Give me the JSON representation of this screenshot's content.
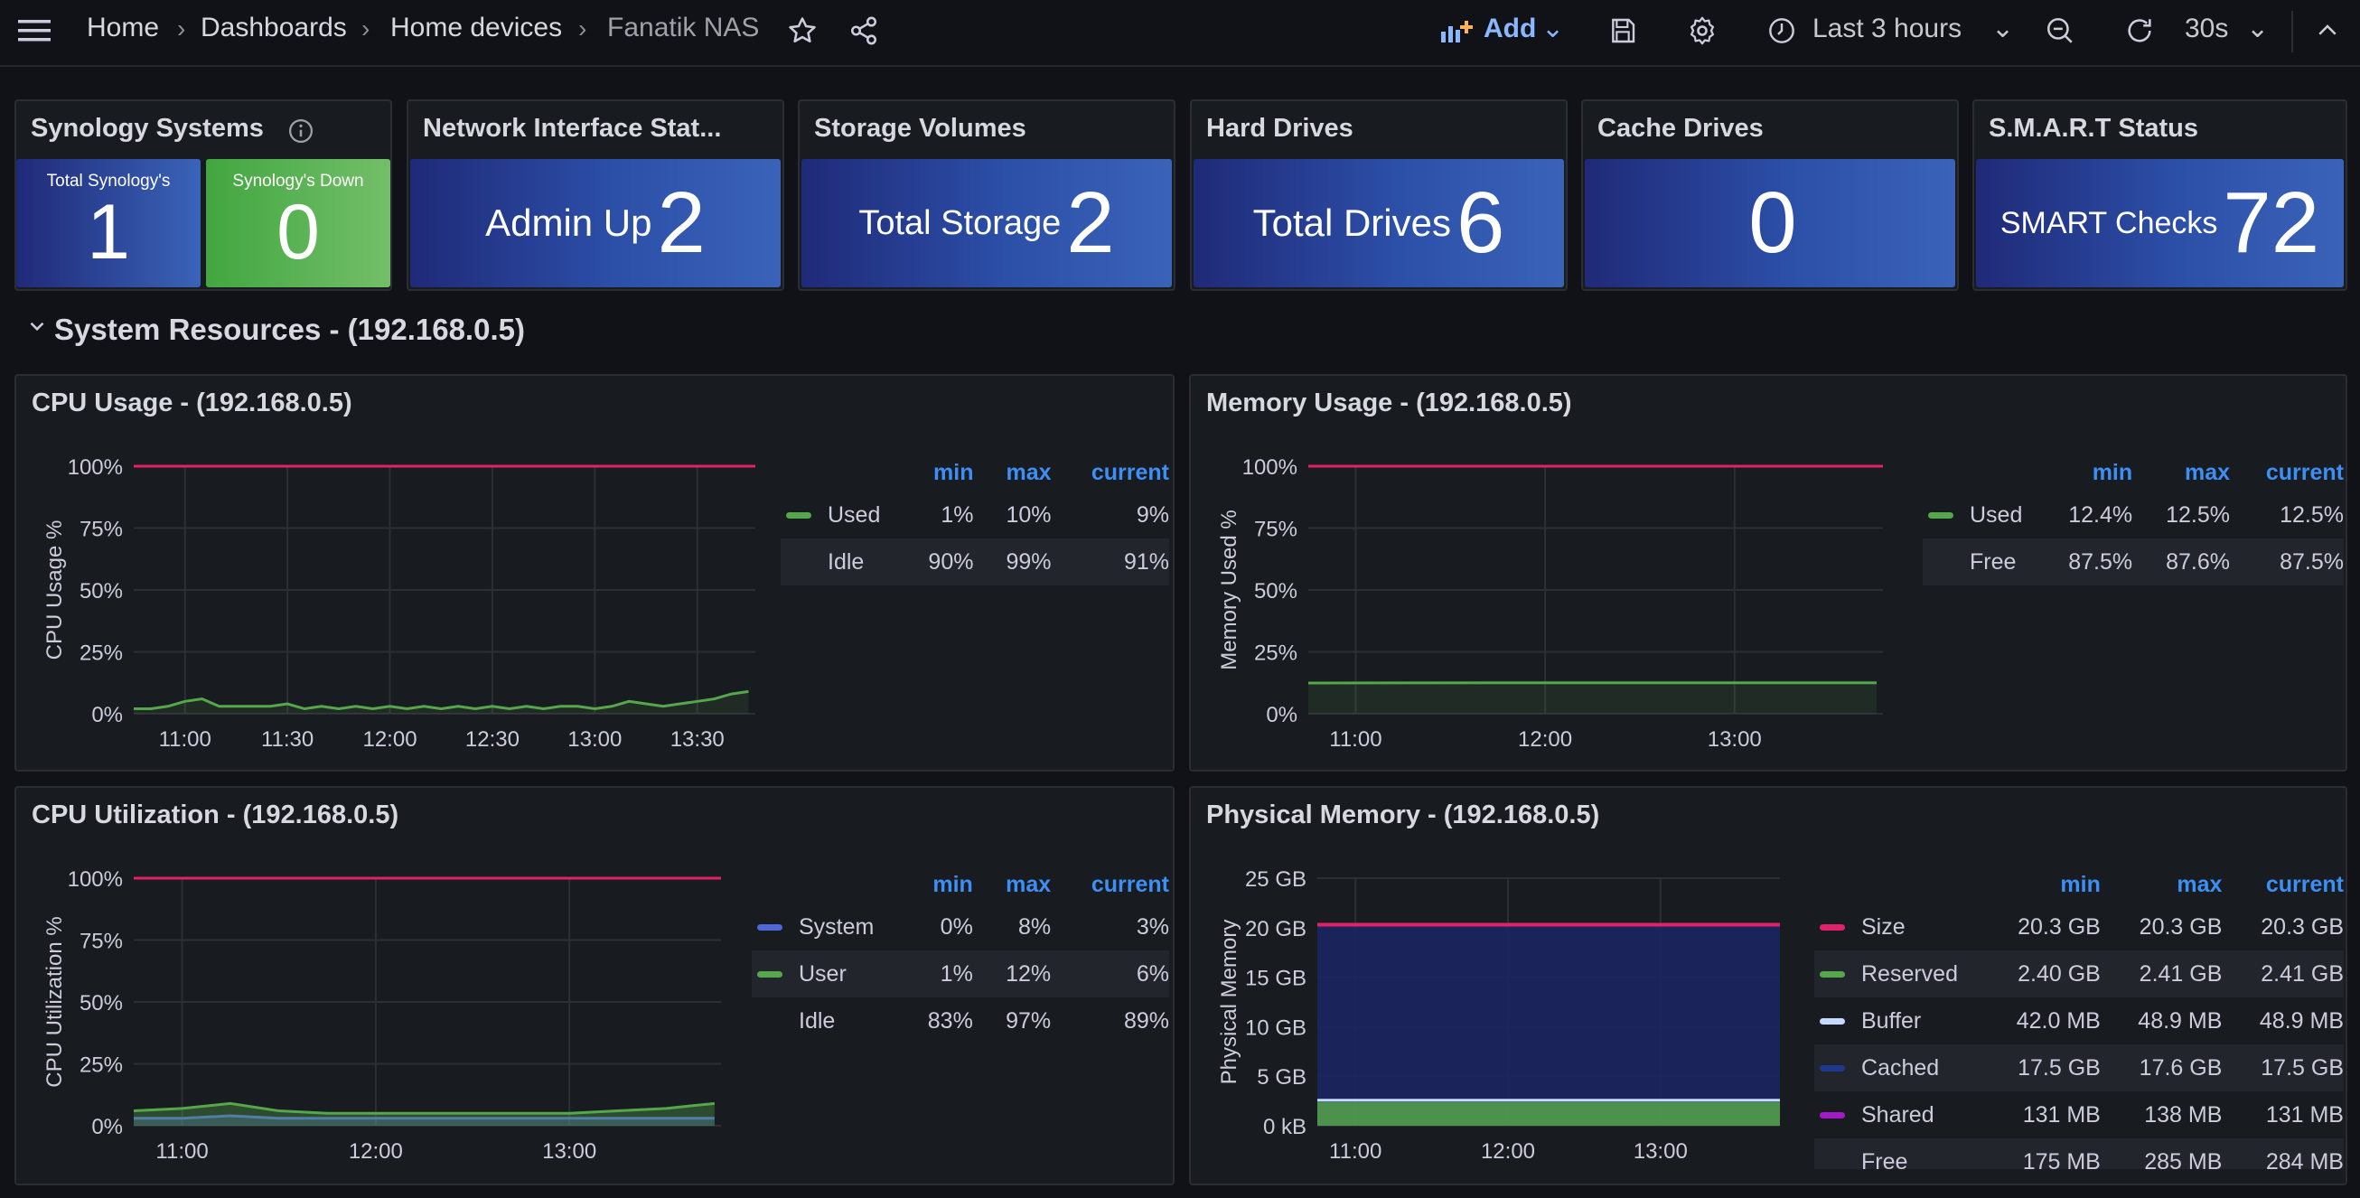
{
  "nav": {
    "breadcrumb": [
      "Home",
      "Dashboards",
      "Home devices",
      "Fanatik NAS"
    ],
    "add_label": "Add",
    "time_range": "Last 3 hours",
    "refresh_interval": "30s"
  },
  "stats": {
    "synology": {
      "title": "Synology Systems",
      "total_label": "Total Synology's",
      "total_value": "1",
      "down_label": "Synology's Down",
      "down_value": "0"
    },
    "network": {
      "title": "Network Interface Stat...",
      "label": "Admin Up",
      "value": "2"
    },
    "storage": {
      "title": "Storage Volumes",
      "label": "Total Storage",
      "value": "2"
    },
    "drives": {
      "title": "Hard Drives",
      "label": "Total Drives",
      "value": "6"
    },
    "cache": {
      "title": "Cache Drives",
      "label": "",
      "value": "0"
    },
    "smart": {
      "title": "S.M.A.R.T Status",
      "label": "SMART Checks",
      "value": "72"
    }
  },
  "row": {
    "title": "System Resources - (192.168.0.5)"
  },
  "colors": {
    "green": "#56a64b",
    "red": "#e0226e",
    "blue": "#5067d8",
    "white": "#c8d9ff",
    "darkblue": "#1f3a8c",
    "purple": "#a31ac7"
  },
  "legend_headers": {
    "min": "min",
    "max": "max",
    "current": "current"
  },
  "cpu_usage": {
    "title": "CPU Usage - (192.168.0.5)",
    "legend": [
      {
        "name": "Used",
        "min": "1%",
        "max": "10%",
        "current": "9%",
        "color": "#56a64b"
      },
      {
        "name": "Idle",
        "min": "90%",
        "max": "99%",
        "current": "91%",
        "color": ""
      }
    ]
  },
  "memory_usage": {
    "title": "Memory Usage - (192.168.0.5)",
    "legend": [
      {
        "name": "Used",
        "min": "12.4%",
        "max": "12.5%",
        "current": "12.5%",
        "color": "#56a64b"
      },
      {
        "name": "Free",
        "min": "87.5%",
        "max": "87.6%",
        "current": "87.5%",
        "color": ""
      }
    ]
  },
  "cpu_util": {
    "title": "CPU Utilization - (192.168.0.5)",
    "legend": [
      {
        "name": "System",
        "min": "0%",
        "max": "8%",
        "current": "3%",
        "color": "#5067d8"
      },
      {
        "name": "User",
        "min": "1%",
        "max": "12%",
        "current": "6%",
        "color": "#56a64b"
      },
      {
        "name": "Idle",
        "min": "83%",
        "max": "97%",
        "current": "89%",
        "color": ""
      }
    ]
  },
  "phys_mem": {
    "title": "Physical Memory - (192.168.0.5)",
    "legend": [
      {
        "name": "Size",
        "min": "20.3 GB",
        "max": "20.3 GB",
        "current": "20.3 GB",
        "color": "#e0226e"
      },
      {
        "name": "Reserved",
        "min": "2.40 GB",
        "max": "2.41 GB",
        "current": "2.41 GB",
        "color": "#56a64b"
      },
      {
        "name": "Buffer",
        "min": "42.0 MB",
        "max": "48.9 MB",
        "current": "48.9 MB",
        "color": "#c8d9ff"
      },
      {
        "name": "Cached",
        "min": "17.5 GB",
        "max": "17.6 GB",
        "current": "17.5 GB",
        "color": "#1f3a8c"
      },
      {
        "name": "Shared",
        "min": "131 MB",
        "max": "138 MB",
        "current": "131 MB",
        "color": "#a31ac7"
      },
      {
        "name": "Free",
        "min": "175 MB",
        "max": "285 MB",
        "current": "284 MB",
        "color": ""
      }
    ]
  },
  "chart_data": [
    {
      "type": "line",
      "title": "CPU Usage - (192.168.0.5)",
      "ylabel": "CPU Usage %",
      "ylim": [
        0,
        100
      ],
      "yticks": [
        "0%",
        "25%",
        "50%",
        "75%",
        "100%"
      ],
      "xticks": [
        "11:00",
        "11:30",
        "12:00",
        "12:30",
        "13:00",
        "13:30"
      ],
      "x": [
        "10:45",
        "10:50",
        "10:55",
        "11:00",
        "11:05",
        "11:10",
        "11:15",
        "11:20",
        "11:25",
        "11:30",
        "11:35",
        "11:40",
        "11:45",
        "11:50",
        "11:55",
        "12:00",
        "12:05",
        "12:10",
        "12:15",
        "12:20",
        "12:25",
        "12:30",
        "12:35",
        "12:40",
        "12:45",
        "12:50",
        "12:55",
        "13:00",
        "13:05",
        "13:10",
        "13:15",
        "13:20",
        "13:25",
        "13:30",
        "13:35",
        "13:40",
        "13:45"
      ],
      "series": [
        {
          "name": "Used",
          "values": [
            2,
            2,
            3,
            5,
            6,
            3,
            3,
            3,
            3,
            4,
            2,
            3,
            2,
            3,
            2,
            3,
            2,
            3,
            2,
            3,
            2,
            3,
            2,
            3,
            2,
            3,
            3,
            2,
            3,
            5,
            4,
            3,
            4,
            5,
            6,
            8,
            9
          ]
        }
      ],
      "threshold": 100
    },
    {
      "type": "line",
      "title": "Memory Usage - (192.168.0.5)",
      "ylabel": "Memory Used %",
      "ylim": [
        0,
        100
      ],
      "yticks": [
        "0%",
        "25%",
        "50%",
        "75%",
        "100%"
      ],
      "xticks": [
        "11:00",
        "12:00",
        "13:00"
      ],
      "x": [
        "10:45",
        "11:45",
        "12:45",
        "13:45"
      ],
      "series": [
        {
          "name": "Used",
          "values": [
            12.4,
            12.5,
            12.5,
            12.5
          ]
        }
      ],
      "threshold": 100
    },
    {
      "type": "area",
      "title": "CPU Utilization - (192.168.0.5)",
      "ylabel": "CPU Utilization %",
      "ylim": [
        0,
        100
      ],
      "yticks": [
        "0%",
        "25%",
        "50%",
        "75%",
        "100%"
      ],
      "xticks": [
        "11:00",
        "12:00",
        "13:00"
      ],
      "x": [
        "10:45",
        "11:00",
        "11:15",
        "11:30",
        "11:45",
        "12:00",
        "12:15",
        "12:30",
        "12:45",
        "13:00",
        "13:15",
        "13:30",
        "13:45"
      ],
      "series": [
        {
          "name": "System",
          "values": [
            3,
            3,
            4,
            3,
            3,
            3,
            3,
            3,
            3,
            3,
            3,
            3,
            3
          ]
        },
        {
          "name": "User",
          "values": [
            6,
            7,
            9,
            6,
            5,
            5,
            5,
            5,
            5,
            5,
            6,
            7,
            9
          ]
        }
      ],
      "threshold": 100
    },
    {
      "type": "area",
      "title": "Physical Memory - (192.168.0.5)",
      "ylabel": "Physical Memory",
      "ylim": [
        0,
        25
      ],
      "yticks": [
        "0 kB",
        "5 GB",
        "10 GB",
        "15 GB",
        "20 GB",
        "25 GB"
      ],
      "xticks": [
        "11:00",
        "12:00",
        "13:00"
      ],
      "x": [
        "10:45",
        "13:45"
      ],
      "series": [
        {
          "name": "Size",
          "values": [
            20.3,
            20.3
          ]
        },
        {
          "name": "Reserved",
          "values": [
            2.4,
            2.41
          ]
        },
        {
          "name": "Cached",
          "values": [
            17.5,
            17.5
          ]
        }
      ]
    }
  ]
}
